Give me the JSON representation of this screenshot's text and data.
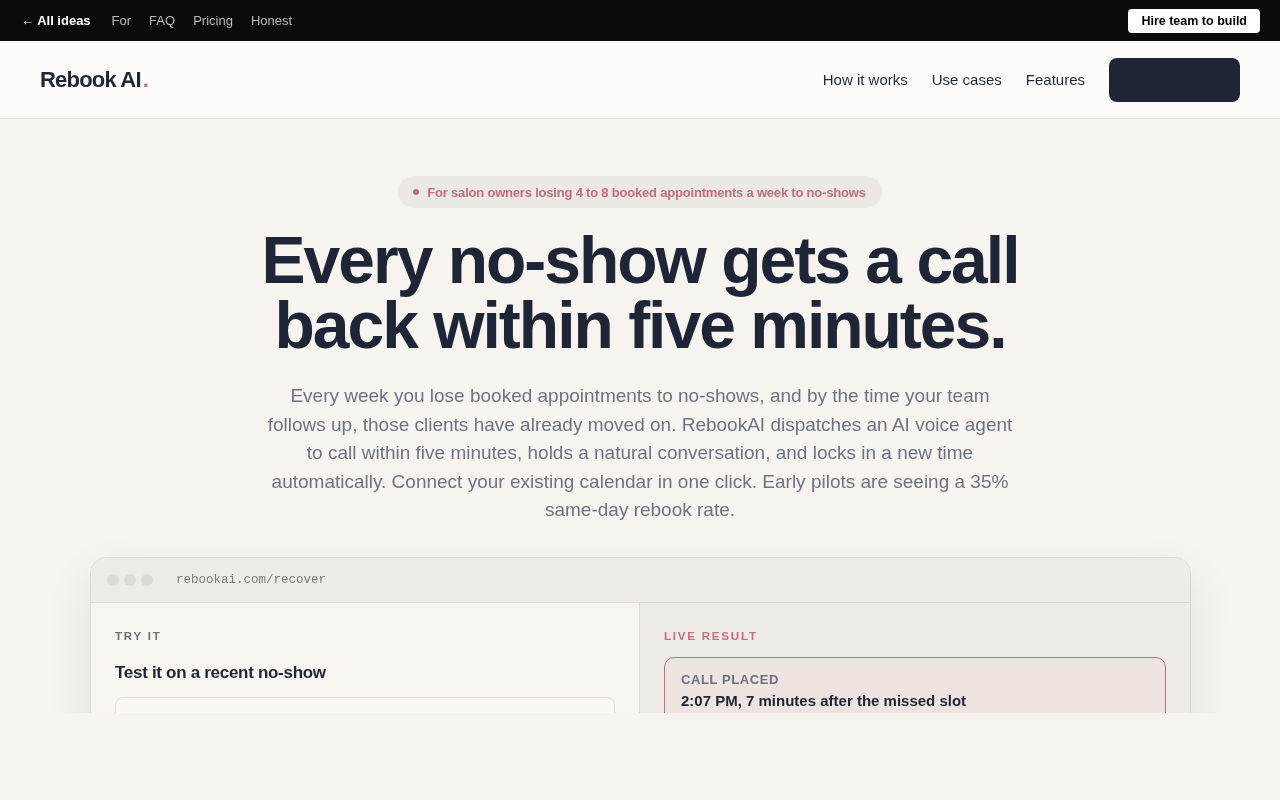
{
  "top_bar": {
    "back_link": "← All ideas",
    "links": [
      "For",
      "FAQ",
      "Pricing",
      "Honest"
    ],
    "button": "Hire team to build"
  },
  "header": {
    "logo": {
      "text": "Rebook AI",
      "mark": "."
    },
    "nav": [
      "How it works",
      "Use cases",
      "Features"
    ]
  },
  "hero": {
    "badge": "For salon owners losing 4 to 8 booked appointments a week to no-shows",
    "title": "Every no-show gets a call back within five minutes.",
    "description": "Every week you lose booked appointments to no-shows, and by the time your team follows up, those clients have already moved on. RebookAI dispatches an AI voice agent to call within five minutes, holds a natural conversation, and locks in a new time automatically. Connect your existing calendar in one click. Early pilots are seeing a 35% same-day rebook rate."
  },
  "demo_window": {
    "url": "rebookai.com/recover",
    "left_panel": {
      "eyebrow": "TRY IT",
      "heading": "Test it on a recent no-show"
    },
    "right_panel": {
      "eyebrow": "LIVE RESULT",
      "result_card": {
        "label": "CALL PLACED",
        "detail": "2:07 PM, 7 minutes after the missed slot"
      }
    }
  }
}
